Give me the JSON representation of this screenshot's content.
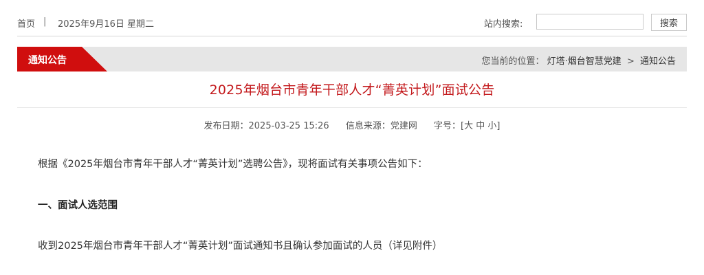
{
  "topbar": {
    "home_label": "首页",
    "separator": "|",
    "date": "2025年9月16日 星期二",
    "search_label": "站内搜索:",
    "search_value": "",
    "search_button": "搜索"
  },
  "section": {
    "tab_label": "通知公告",
    "location_prefix": "您当前的位置：",
    "breadcrumb": [
      "灯塔·烟台智慧党建",
      "通知公告"
    ],
    "breadcrumb_separator": ">",
    "tab_color": "#d00e0e"
  },
  "article": {
    "title": "2025年烟台市青年干部人才“菁英计划”面试公告",
    "meta": {
      "publish_date_label": "发布日期：",
      "publish_date": "2025-03-25 15:26",
      "source_label": "信息来源：",
      "source": "党建网",
      "fontsize_label": "字号：",
      "fontsize_open": "[",
      "fontsize_options": [
        "大",
        "中",
        "小"
      ],
      "fontsize_close": "]"
    },
    "paragraphs": [
      "根据《2025年烟台市青年干部人才“菁英计划”选聘公告》，现将面试有关事项公告如下：",
      "一、面试人选范围",
      "收到2025年烟台市青年干部人才“菁英计划”面试通知书且确认参加面试的人员（详见附件）"
    ],
    "title_color": "#c3191c"
  }
}
